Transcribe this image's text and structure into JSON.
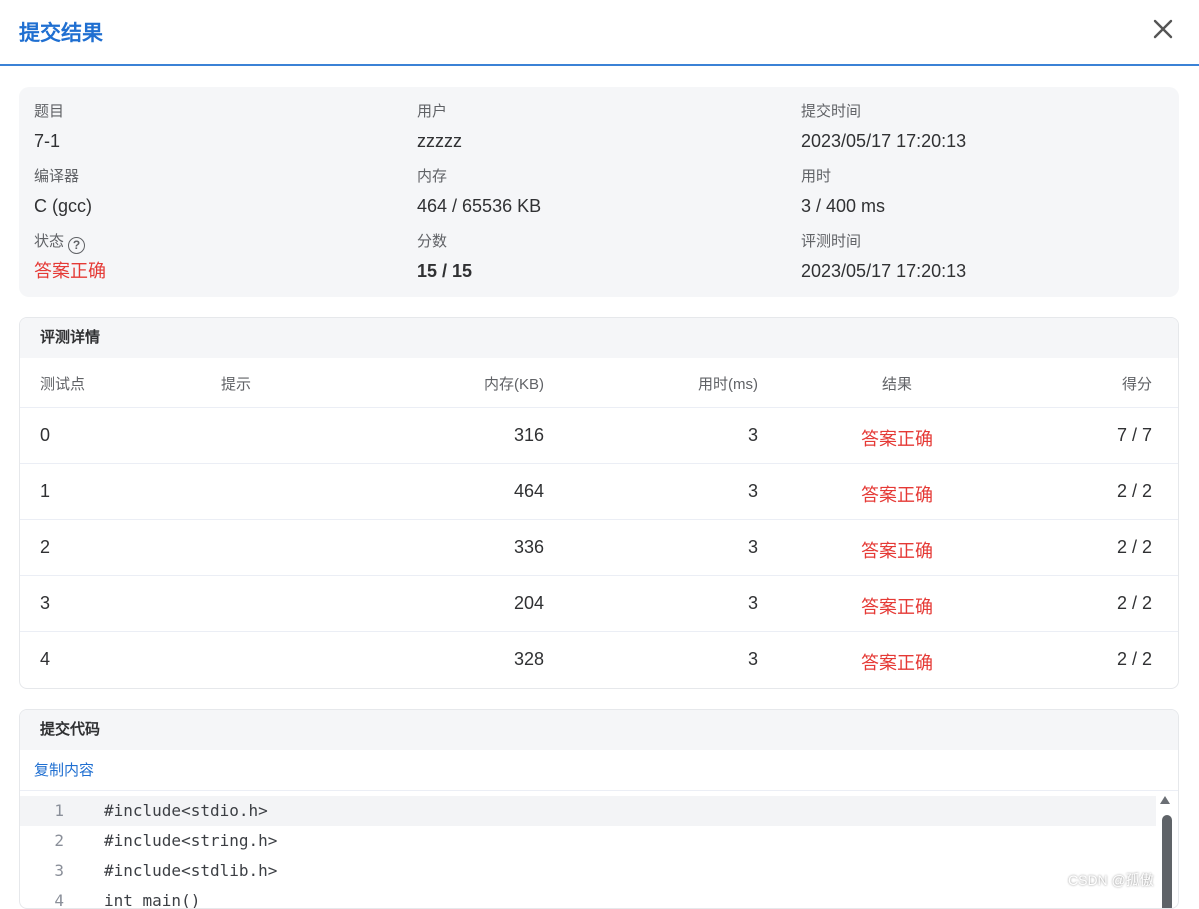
{
  "dialog": {
    "title": "提交结果",
    "close_icon": "close-icon"
  },
  "info": {
    "problem": {
      "label": "题目",
      "value": "7-1"
    },
    "user": {
      "label": "用户",
      "value": "zzzzz"
    },
    "submit_time": {
      "label": "提交时间",
      "value": "2023/05/17 17:20:13"
    },
    "compiler": {
      "label": "编译器",
      "value": "C (gcc)"
    },
    "memory": {
      "label": "内存",
      "value": "464 / 65536 KB"
    },
    "time_used": {
      "label": "用时",
      "value": "3 / 400 ms"
    },
    "status": {
      "label": "状态",
      "value": "答案正确",
      "help_icon": "?"
    },
    "score": {
      "label": "分数",
      "value": "15 / 15"
    },
    "judge_time": {
      "label": "评测时间",
      "value": "2023/05/17 17:20:13"
    }
  },
  "judge_detail": {
    "title": "评测详情",
    "columns": [
      "测试点",
      "提示",
      "内存(KB)",
      "用时(ms)",
      "结果",
      "得分"
    ],
    "rows": [
      {
        "case": "0",
        "hint": "",
        "memory": "316",
        "time": "3",
        "result": "答案正确",
        "score": "7 / 7"
      },
      {
        "case": "1",
        "hint": "",
        "memory": "464",
        "time": "3",
        "result": "答案正确",
        "score": "2 / 2"
      },
      {
        "case": "2",
        "hint": "",
        "memory": "336",
        "time": "3",
        "result": "答案正确",
        "score": "2 / 2"
      },
      {
        "case": "3",
        "hint": "",
        "memory": "204",
        "time": "3",
        "result": "答案正确",
        "score": "2 / 2"
      },
      {
        "case": "4",
        "hint": "",
        "memory": "328",
        "time": "3",
        "result": "答案正确",
        "score": "2 / 2"
      }
    ]
  },
  "code": {
    "title": "提交代码",
    "copy_label": "复制内容",
    "lines": [
      {
        "num": "1",
        "text": "#include<stdio.h>"
      },
      {
        "num": "2",
        "text": "#include<string.h>"
      },
      {
        "num": "3",
        "text": "#include<stdlib.h>"
      },
      {
        "num": "4",
        "text": "int main()"
      }
    ]
  },
  "watermark": "CSDN @孤傲"
}
